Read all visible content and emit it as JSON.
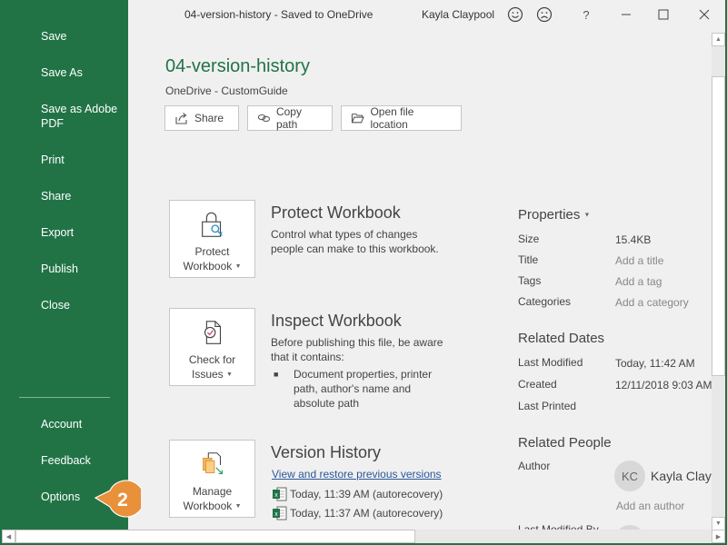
{
  "window": {
    "title": "04-version-history - Saved to OneDrive",
    "user": "Kayla Claypool",
    "icons": [
      "smiley-icon",
      "frown-icon",
      "help-icon",
      "minimize-icon",
      "maximize-icon",
      "close-icon"
    ],
    "help_glyph": "?"
  },
  "sidebar": {
    "items": [
      {
        "label": "Save"
      },
      {
        "label": "Save As"
      },
      {
        "label": "Save as Adobe PDF"
      },
      {
        "label": "Print"
      },
      {
        "label": "Share"
      },
      {
        "label": "Export"
      },
      {
        "label": "Publish"
      },
      {
        "label": "Close"
      }
    ],
    "bottom_items": [
      {
        "label": "Account"
      },
      {
        "label": "Feedback"
      },
      {
        "label": "Options"
      }
    ]
  },
  "callout": {
    "number": "2",
    "color": "#e8913a"
  },
  "document": {
    "title": "04-version-history",
    "location": "OneDrive - CustomGuide",
    "actions": [
      {
        "label": "Share",
        "icon": "share-icon"
      },
      {
        "label": "Copy path",
        "icon": "link-icon"
      },
      {
        "label": "Open file location",
        "icon": "folder-icon"
      }
    ]
  },
  "sections": {
    "protect": {
      "button_line1": "Protect",
      "button_line2": "Workbook",
      "title": "Protect Workbook",
      "desc": "Control what types of changes people can make to this workbook."
    },
    "inspect": {
      "button_line1": "Check for",
      "button_line2": "Issues",
      "title": "Inspect Workbook",
      "desc": "Before publishing this file, be aware that it contains:",
      "bullet": "Document properties, printer path, author's name and absolute path"
    },
    "versions": {
      "button_line1": "Manage",
      "button_line2": "Workbook",
      "title": "Version History",
      "link": "View and restore previous versions",
      "entries": [
        {
          "label": "Today, 11:39 AM (autorecovery)"
        },
        {
          "label": "Today, 11:37 AM (autorecovery)"
        }
      ]
    }
  },
  "properties": {
    "heading": "Properties",
    "rows": [
      {
        "label": "Size",
        "value": "15.4KB",
        "placeholder": false
      },
      {
        "label": "Title",
        "value": "Add a title",
        "placeholder": true
      },
      {
        "label": "Tags",
        "value": "Add a tag",
        "placeholder": true
      },
      {
        "label": "Categories",
        "value": "Add a category",
        "placeholder": true
      }
    ]
  },
  "related_dates": {
    "heading": "Related Dates",
    "rows": [
      {
        "label": "Last Modified",
        "value": "Today, 11:42 AM"
      },
      {
        "label": "Created",
        "value": "12/11/2018 9:03 AM"
      },
      {
        "label": "Last Printed",
        "value": ""
      }
    ]
  },
  "related_people": {
    "heading": "Related People",
    "author_label": "Author",
    "author_initials": "KC",
    "author_name": "Kayla Claypool",
    "add_author": "Add an author",
    "last_modified_by_label": "Last Modified By"
  },
  "colors": {
    "sidebar": "#217346",
    "accent_title": "#217346",
    "link": "#2b579a",
    "callout": "#e8913a"
  }
}
